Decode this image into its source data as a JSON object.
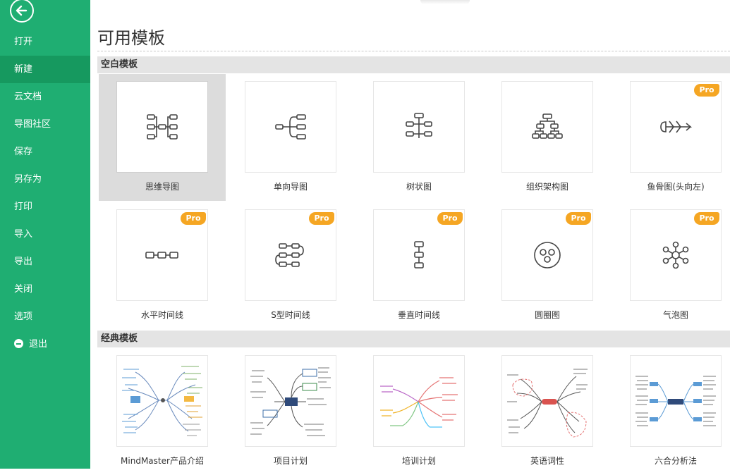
{
  "sidebar": {
    "items": [
      {
        "label": "打开",
        "active": false
      },
      {
        "label": "新建",
        "active": true
      },
      {
        "label": "云文档",
        "active": false
      },
      {
        "label": "导图社区",
        "active": false
      },
      {
        "label": "保存",
        "active": false
      },
      {
        "label": "另存为",
        "active": false
      },
      {
        "label": "打印",
        "active": false
      },
      {
        "label": "导入",
        "active": false
      },
      {
        "label": "导出",
        "active": false
      },
      {
        "label": "关闭",
        "active": false
      },
      {
        "label": "选项",
        "active": false
      },
      {
        "label": "退出",
        "active": false
      }
    ]
  },
  "main": {
    "title": "可用模板",
    "sections": [
      {
        "title": "空白模板",
        "templates": [
          {
            "label": "思维导图",
            "pro": false,
            "icon": "mindmap-icon"
          },
          {
            "label": "单向导图",
            "pro": false,
            "icon": "right-map-icon"
          },
          {
            "label": "树状图",
            "pro": false,
            "icon": "tree-map-icon"
          },
          {
            "label": "组织架构图",
            "pro": false,
            "icon": "org-chart-icon"
          },
          {
            "label": "鱼骨图(头向左)",
            "pro": true,
            "icon": "fishbone-icon"
          },
          {
            "label": "水平时间线",
            "pro": true,
            "icon": "horizontal-timeline-icon"
          },
          {
            "label": "S型时间线",
            "pro": true,
            "icon": "s-timeline-icon"
          },
          {
            "label": "垂直时间线",
            "pro": true,
            "icon": "vertical-timeline-icon"
          },
          {
            "label": "圆圈图",
            "pro": true,
            "icon": "circle-map-icon"
          },
          {
            "label": "气泡图",
            "pro": true,
            "icon": "bubble-map-icon"
          }
        ]
      },
      {
        "title": "经典模板",
        "templates": [
          {
            "label": "MindMaster产品介绍",
            "pro": false,
            "icon": "thumbnail-product-intro"
          },
          {
            "label": "项目计划",
            "pro": false,
            "icon": "thumbnail-project-plan"
          },
          {
            "label": "培训计划",
            "pro": false,
            "icon": "thumbnail-training-plan"
          },
          {
            "label": "英语词性",
            "pro": false,
            "icon": "thumbnail-english-pos"
          },
          {
            "label": "六合分析法",
            "pro": false,
            "icon": "thumbnail-six-analysis"
          }
        ]
      }
    ],
    "pro_badge": "Pro"
  },
  "colors": {
    "sidebar_bg": "#1fae72",
    "sidebar_active": "#16995f",
    "pro_badge": "#f5a623",
    "section_bg": "#e4e4e4"
  }
}
